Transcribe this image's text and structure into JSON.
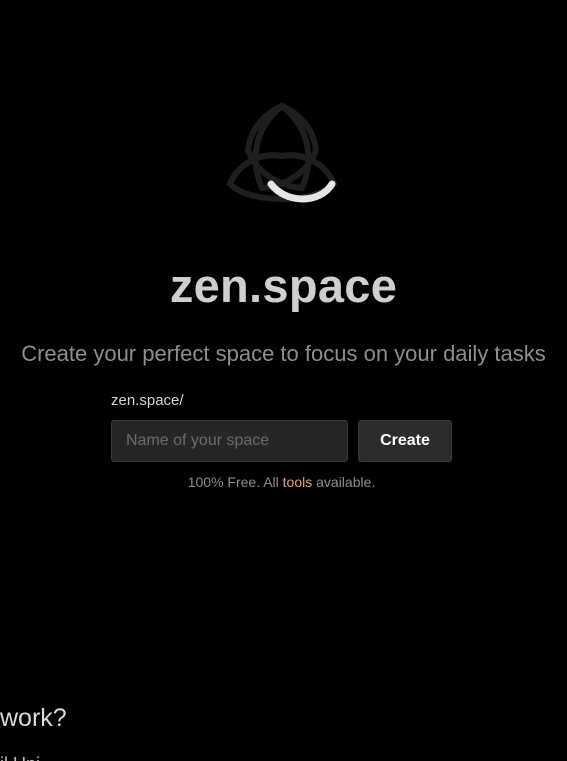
{
  "hero": {
    "logo_icon": "triquetra-smile-icon",
    "brand": "zen.space",
    "tagline": "Create your perfect space to focus on your daily tasks"
  },
  "form": {
    "prefix": "zen.space/",
    "input_value": "",
    "input_placeholder": "Name of your space",
    "create_label": "Create"
  },
  "note": {
    "before": "100% Free. All ",
    "link": "tools",
    "after": " available."
  },
  "section": {
    "heading": "work?",
    "body": "il Uni"
  },
  "colors": {
    "background": "#000000",
    "logo_dim": "#1f1f1f",
    "logo_smile": "#e6e6e6",
    "accent_link": "#e3a35a"
  }
}
